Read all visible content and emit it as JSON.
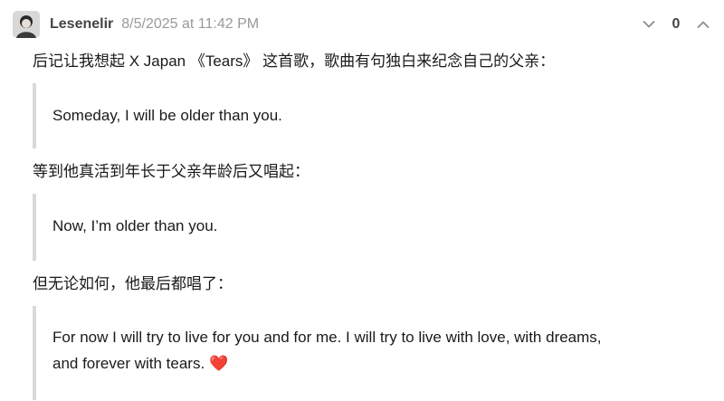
{
  "comment": {
    "author": "Lesenelir",
    "timestamp": "8/5/2025 at 11:42 PM",
    "vote_count": "0",
    "paragraphs": {
      "p1": "后记让我想起 X Japan 《Tears》 这首歌，歌曲有句独白来纪念自己的父亲：",
      "p2": "等到他真活到年长于父亲年龄后又唱起：",
      "p3": "但无论如何，他最后都唱了："
    },
    "quotes": {
      "q1": "Someday, I will be older than you.",
      "q2": "Now, I’m older than you.",
      "q3_line1": "For now I will try to live for you and for me. I will try to live with love, with dreams,",
      "q3_line2": "and forever with tears.",
      "q3_emoji": "❤️"
    }
  },
  "icons": {
    "avatar": "avatar-image",
    "downvote": "chevron-down-icon",
    "upvote": "chevron-up-icon"
  },
  "colors": {
    "text": "#1a1a1a",
    "author": "#444444",
    "timestamp": "#9a9a9a",
    "quote_bar": "#d9d9d9",
    "heart": "#e0202b"
  }
}
